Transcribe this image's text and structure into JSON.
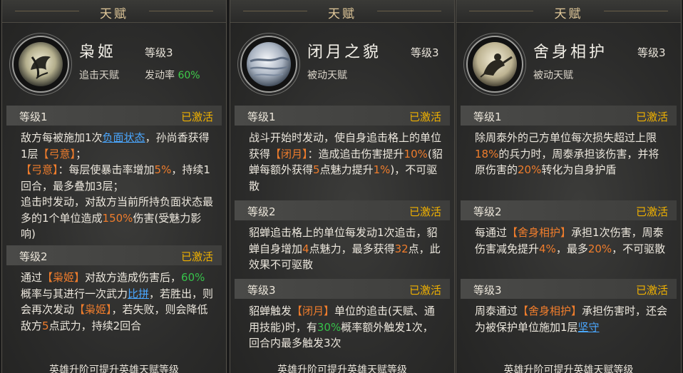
{
  "header_title": "天赋",
  "status_label": "已激活",
  "footer": "英雄升阶可提升英雄天赋等级",
  "colors": {
    "gold": "#f0b100",
    "orange": "#f07d2c",
    "green": "#36c24a",
    "blue": "#4aa7ff"
  },
  "panels": [
    {
      "icon": "owl-talent-icon",
      "name": "枭姬",
      "level": "等级3",
      "type": "追击天赋",
      "rate_label": "发动率",
      "rate_value": "60%",
      "levels": [
        {
          "label": "等级1",
          "segments": [
            {
              "t": "敌方每被施加1次",
              "c": ""
            },
            {
              "t": "负面状态",
              "c": "b"
            },
            {
              "t": "，孙尚香获得1层",
              "c": ""
            },
            {
              "t": "【弓意】",
              "c": "o"
            },
            {
              "t": "；",
              "c": ""
            },
            {
              "br": true
            },
            {
              "t": "【弓意】",
              "c": "o"
            },
            {
              "t": "：每层使暴击率增加",
              "c": ""
            },
            {
              "t": "5%",
              "c": "o"
            },
            {
              "t": "，持续1回合，最多叠加3层；",
              "c": ""
            },
            {
              "br": true
            },
            {
              "t": "追击时发动，对敌方当前所持负面状态最多的1个单位造成",
              "c": ""
            },
            {
              "t": "150%",
              "c": "o"
            },
            {
              "t": "伤害(受魅力影响)",
              "c": ""
            }
          ]
        },
        {
          "label": "等级2",
          "segments": [
            {
              "t": "通过",
              "c": ""
            },
            {
              "t": "【枭姬】",
              "c": "o"
            },
            {
              "t": "对敌方造成伤害后，",
              "c": ""
            },
            {
              "t": "60%",
              "c": "gr"
            },
            {
              "t": "概率与其进行一次武力",
              "c": ""
            },
            {
              "t": "比拼",
              "c": "b"
            },
            {
              "t": "，若胜出，则会再次发动",
              "c": ""
            },
            {
              "t": "【枭姬】",
              "c": "o"
            },
            {
              "t": "，若失败，则会降低敌方",
              "c": ""
            },
            {
              "t": "5",
              "c": "o"
            },
            {
              "t": "点武力，持续2回合",
              "c": ""
            }
          ]
        }
      ]
    },
    {
      "icon": "moon-talent-icon",
      "name": "闭月之貌",
      "level": "等级3",
      "type": "被动天赋",
      "levels": [
        {
          "label": "等级1",
          "segments": [
            {
              "t": "战斗开始时发动，使自身追击格上的单位获得",
              "c": ""
            },
            {
              "t": "【闭月】",
              "c": "o"
            },
            {
              "t": "：造成追击伤害提升",
              "c": ""
            },
            {
              "t": "10%",
              "c": "o"
            },
            {
              "t": "(貂蝉每额外获得",
              "c": ""
            },
            {
              "t": "5",
              "c": "o"
            },
            {
              "t": "点魅力提升",
              "c": ""
            },
            {
              "t": "1%",
              "c": "o"
            },
            {
              "t": ")，不可驱散",
              "c": ""
            }
          ]
        },
        {
          "label": "等级2",
          "segments": [
            {
              "t": "貂蝉追击格上的单位每发动1次追击，貂蝉自身增加",
              "c": ""
            },
            {
              "t": "4",
              "c": "o"
            },
            {
              "t": "点魅力，最多获得",
              "c": ""
            },
            {
              "t": "32",
              "c": "o"
            },
            {
              "t": "点，此效果不可驱散",
              "c": ""
            }
          ]
        },
        {
          "label": "等级3",
          "segments": [
            {
              "t": "貂蝉触发",
              "c": ""
            },
            {
              "t": "【闭月】",
              "c": "o"
            },
            {
              "t": "单位的追击(天赋、通用技能)时，有",
              "c": ""
            },
            {
              "t": "30%",
              "c": "gr"
            },
            {
              "t": "概率额外触发1次，回合内最多触发3次",
              "c": ""
            }
          ]
        }
      ]
    },
    {
      "icon": "guardian-talent-icon",
      "name": "舍身相护",
      "level": "等级3",
      "type": "被动天赋",
      "levels": [
        {
          "label": "等级1",
          "segments": [
            {
              "t": "除周泰外的己方单位每次损失超过上限",
              "c": ""
            },
            {
              "t": "18%",
              "c": "o"
            },
            {
              "t": "的兵力时，周泰承担该伤害，并将原伤害的",
              "c": ""
            },
            {
              "t": "20%",
              "c": "o"
            },
            {
              "t": "转化为自身护盾",
              "c": ""
            }
          ]
        },
        {
          "label": "等级2",
          "segments": [
            {
              "t": "每通过",
              "c": ""
            },
            {
              "t": "【舍身相护】",
              "c": "o"
            },
            {
              "t": "承担1次伤害，周泰伤害减免提升",
              "c": ""
            },
            {
              "t": "4%",
              "c": "o"
            },
            {
              "t": "，最多",
              "c": ""
            },
            {
              "t": "20%",
              "c": "o"
            },
            {
              "t": "，不可驱散",
              "c": ""
            }
          ]
        },
        {
          "label": "等级3",
          "segments": [
            {
              "t": "周泰通过",
              "c": ""
            },
            {
              "t": "【舍身相护】",
              "c": "o"
            },
            {
              "t": "承担伤害时，还会为被保护单位施加1层",
              "c": ""
            },
            {
              "t": "坚守",
              "c": "b"
            }
          ]
        }
      ]
    }
  ]
}
